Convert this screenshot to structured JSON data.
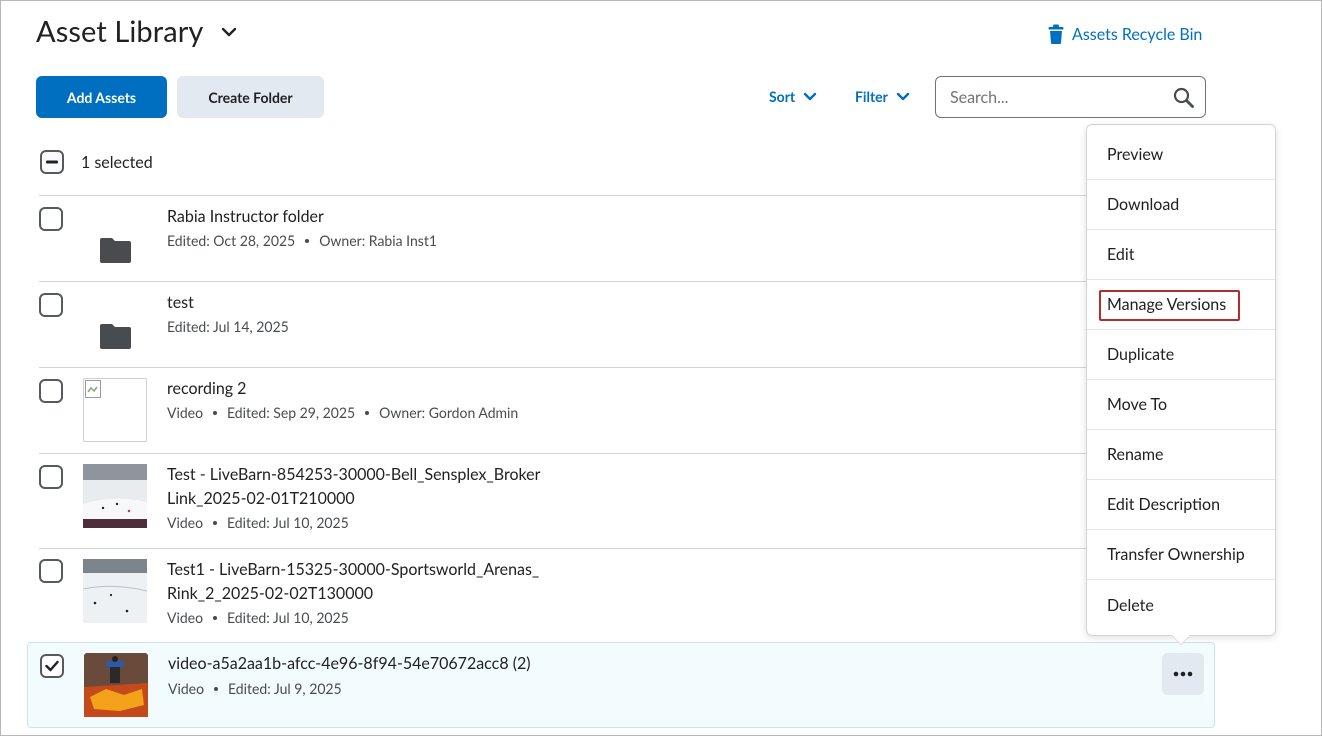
{
  "header": {
    "title": "Asset Library",
    "recycle_bin": "Assets Recycle Bin"
  },
  "toolbar": {
    "add_assets": "Add Assets",
    "create_folder": "Create Folder",
    "sort": "Sort",
    "filter": "Filter",
    "search_placeholder": "Search..."
  },
  "selection": {
    "text": "1 selected"
  },
  "rows": [
    {
      "name": "Rabia Instructor folder",
      "meta": [
        "Edited: Oct 28, 2025",
        "Owner: Rabia Inst1"
      ],
      "type": "folder",
      "checked": false
    },
    {
      "name": "test",
      "meta": [
        "Edited: Jul 14, 2025"
      ],
      "type": "folder",
      "checked": false
    },
    {
      "name": "recording 2",
      "meta": [
        "Video",
        "Edited: Sep 29, 2025",
        "Owner: Gordon Admin"
      ],
      "type": "broken-image",
      "checked": false
    },
    {
      "name_line1": "Test - LiveBarn-854253-30000-Bell_Sensplex_Broker",
      "name_line2": "Link_2025-02-01T210000",
      "meta": [
        "Video",
        "Edited: Jul 10, 2025"
      ],
      "type": "rink-thumb",
      "checked": false
    },
    {
      "name_line1": "Test1 - LiveBarn-15325-30000-Sportsworld_Arenas_",
      "name_line2": "Rink_2_2025-02-02T130000",
      "meta": [
        "Video",
        "Edited: Jul 10, 2025"
      ],
      "type": "rink-thumb",
      "checked": false
    },
    {
      "name": "video-a5a2aa1b-afcc-4e96-8f94-54e70672acc8 (2)",
      "meta": [
        "Video",
        "Edited: Jul 9, 2025"
      ],
      "type": "robot-thumb",
      "checked": true
    }
  ],
  "context_menu": {
    "items": [
      "Preview",
      "Download",
      "Edit",
      "Manage Versions",
      "Duplicate",
      "Move To",
      "Rename",
      "Edit Description",
      "Transfer Ownership",
      "Delete"
    ],
    "highlighted": "Manage Versions"
  },
  "colors": {
    "primary": "#006fbf",
    "secondary_button": "#e3e9f1",
    "highlight": "#b42d2d",
    "selected_row": "#f2fbfd"
  }
}
